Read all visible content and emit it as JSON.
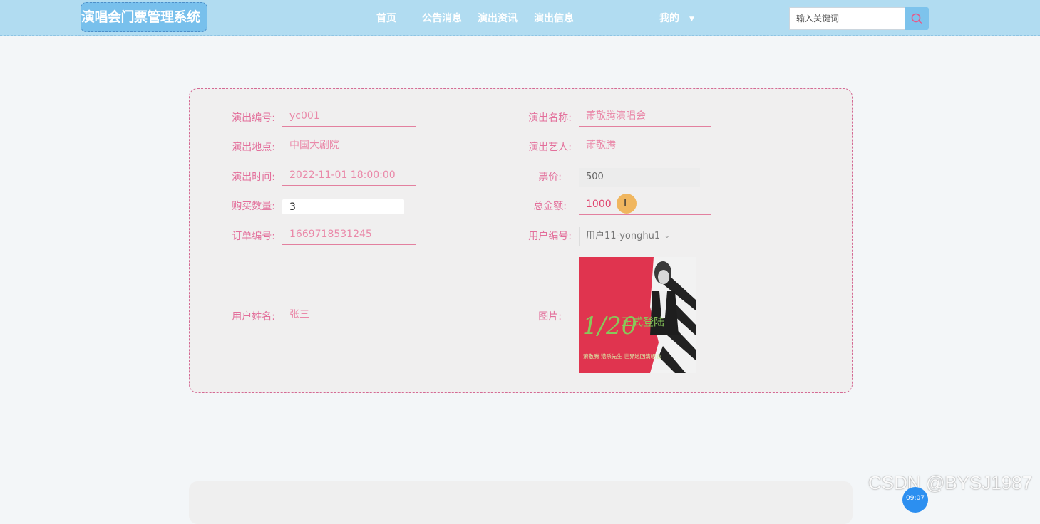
{
  "header": {
    "brand": "演唱会门票管理系统",
    "nav": [
      "首页",
      "公告消息",
      "演出资讯",
      "演出信息"
    ],
    "user_menu": "我的",
    "search_placeholder": "输入关键词"
  },
  "form": {
    "show_no_label": "演出编号:",
    "show_no": "yc001",
    "show_name_label": "演出名称:",
    "show_name": "萧敬腾演唱会",
    "venue_label": "演出地点:",
    "venue": "中国大剧院",
    "artist_label": "演出艺人:",
    "artist": "萧敬腾",
    "time_label": "演出时间:",
    "time": "2022-11-01 18:00:00",
    "price_label": "票价:",
    "price": "500",
    "qty_label": "购买数量:",
    "qty": "3",
    "total_label": "总金额:",
    "total": "1000",
    "order_no_label": "订单编号:",
    "order_no": "1669718531245",
    "user_no_label": "用户编号:",
    "user_no": "用户11-yonghu1",
    "user_name_label": "用户姓名:",
    "user_name": "张三",
    "image_label": "图片:"
  },
  "poster": {
    "date": "1/20",
    "headline": "正式登陆",
    "tagline": "萧敬腾 猎杀先生 世界巡回演唱会"
  },
  "watermark": "CSDN @BYSJ1987",
  "clock": "09:07",
  "colors": {
    "navbar": "#b1dcf1",
    "accent_pink": "#e36f9b",
    "card_bg": "#f0efef",
    "poster_red": "#e0344f"
  }
}
